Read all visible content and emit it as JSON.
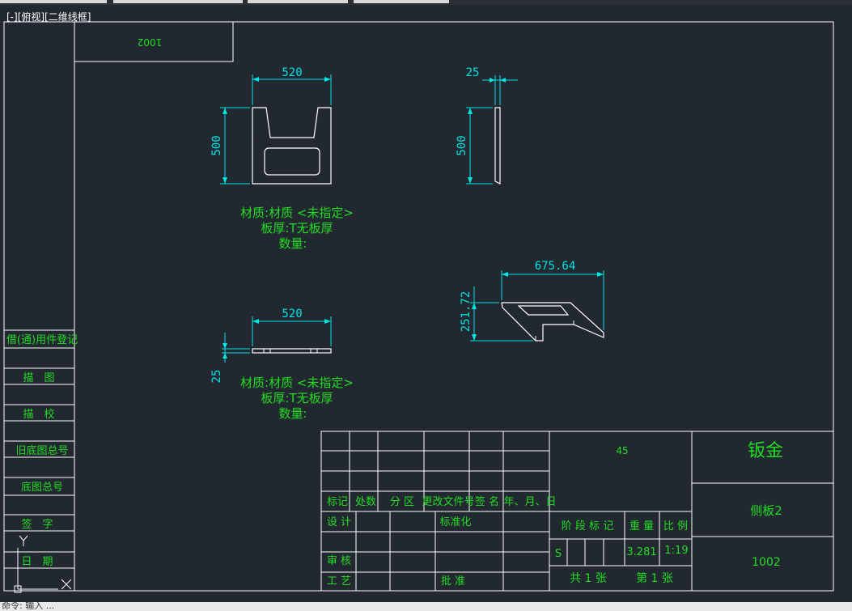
{
  "viewport": {
    "label": "[-][俯视][二维线框]"
  },
  "drawing": {
    "part_number_mirrored": "1002",
    "front_view": {
      "width": "520",
      "height": "500"
    },
    "side_view": {
      "thickness": "25",
      "height": "500"
    },
    "top_view": {
      "width": "520",
      "thickness": "25"
    },
    "iso_view": {
      "length": "675.64",
      "height": "251.72"
    },
    "note_material": "材质:材质 <未指定>",
    "note_thickness": "板厚:T无板厚",
    "note_quantity": "数量:"
  },
  "side_column": {
    "items": [
      "借(通)用件登记",
      "描　图",
      "描　校",
      "旧底图总号",
      "底图总号",
      "签　字",
      "日　期"
    ]
  },
  "title_block": {
    "header_labels": [
      "标记",
      "处数",
      "分 区",
      "更改文件号",
      "签 名",
      "年、月、日"
    ],
    "design": "设 计",
    "review": "审 核",
    "process": "工 艺",
    "standardization": "标准化",
    "approval": "批 准",
    "stage_mark": "阶 段 标 记",
    "weight_label": "重 量",
    "scale_label": "比 例",
    "material_code": "45",
    "stage_value": "S",
    "weight_value": "3.281",
    "scale_value": "1:19",
    "sheets_total": "共  1  张",
    "sheet_current": "第  1  张",
    "material_name": "钣金",
    "part_name": "侧板2",
    "part_number": "1002"
  },
  "ucs": {
    "y_label": "Y",
    "x_label": "X"
  },
  "status_text": "命令: 输入 ..."
}
